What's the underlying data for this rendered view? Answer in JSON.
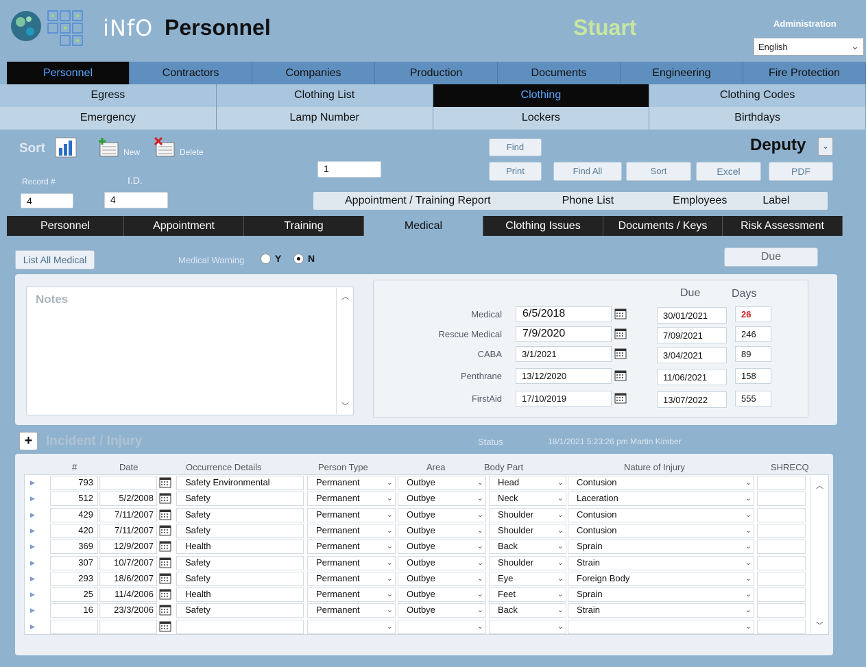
{
  "header": {
    "logo_text": "iNfO",
    "app_title": "Personnel",
    "user_name": "Stuart",
    "admin_label": "Administration",
    "language": "English"
  },
  "main_nav": [
    "Personnel",
    "Contractors",
    "Companies",
    "Production",
    "Documents",
    "Engineering",
    "Fire Protection"
  ],
  "main_nav_active": 0,
  "sub_nav_row1": [
    "Egress",
    "Clothing List",
    "Clothing",
    "Clothing Codes"
  ],
  "sub_nav_row1_active": 2,
  "sub_nav_row2": [
    "Emergency",
    "Lamp Number",
    "Lockers",
    "Birthdays"
  ],
  "toolbar": {
    "sort_label": "Sort",
    "new_label": "New",
    "delete_label": "Delete",
    "find": "Find",
    "print": "Print",
    "find_all": "Find All",
    "sort": "Sort",
    "excel": "Excel",
    "pdf": "PDF",
    "deputy": "Deputy",
    "count": "1",
    "record_label": "Record #",
    "id_label": "I.D.",
    "record_value": "4",
    "id_value": "4"
  },
  "reports": [
    "Appointment / Training Report",
    "Phone List",
    "Employees",
    "Label"
  ],
  "record_tabs": [
    "Personnel",
    "Appointment",
    "Training",
    "Medical",
    "Clothing Issues",
    "Documents / Keys",
    "Risk Assessment"
  ],
  "record_tabs_active": 3,
  "medical": {
    "list_all": "List All Medical",
    "warning_label": "Medical Warning",
    "radio_y": "Y",
    "radio_n": "N",
    "radio_selected": "N",
    "due_button": "Due",
    "notes_label": "Notes",
    "due_head": "Due",
    "days_head": "Days",
    "rows": [
      {
        "label": "Medical",
        "date": "6/5/2018",
        "due": "30/01/2021",
        "days": "26",
        "overdue": true
      },
      {
        "label": "Rescue Medical",
        "date": "7/9/2020",
        "due": "7/09/2021",
        "days": "246",
        "overdue": false
      },
      {
        "label": "CABA",
        "date": "3/1/2021",
        "due": "3/04/2021",
        "days": "89",
        "overdue": false
      },
      {
        "label": "Penthrane",
        "date": "13/12/2020",
        "due": "11/06/2021",
        "days": "158",
        "overdue": false
      },
      {
        "label": "FirstAid",
        "date": "17/10/2019",
        "due": "13/07/2022",
        "days": "555",
        "overdue": false
      }
    ]
  },
  "incident": {
    "add": "+",
    "title": "Incident / Injury",
    "status_label": "Status",
    "status_value": "18/1/2021 5:23:26 pm Martin Kimber",
    "columns": {
      "num": "#",
      "date": "Date",
      "occurrence": "Occurrence Details",
      "person_type": "Person Type",
      "area": "Area",
      "body_part": "Body Part",
      "nature": "Nature of Injury",
      "shrecq": "SHRECQ"
    },
    "rows": [
      {
        "num": "793",
        "date": "",
        "occurrence": "Safety Environmental",
        "person_type": "Permanent",
        "area": "Outbye",
        "body_part": "Head",
        "nature": "Contusion"
      },
      {
        "num": "512",
        "date": "5/2/2008",
        "occurrence": "Safety",
        "person_type": "Permanent",
        "area": "Outbye",
        "body_part": "Neck",
        "nature": "Laceration"
      },
      {
        "num": "429",
        "date": "7/11/2007",
        "occurrence": "Safety",
        "person_type": "Permanent",
        "area": "Outbye",
        "body_part": "Shoulder",
        "nature": "Contusion"
      },
      {
        "num": "420",
        "date": "7/11/2007",
        "occurrence": "Safety",
        "person_type": "Permanent",
        "area": "Outbye",
        "body_part": "Shoulder",
        "nature": "Contusion"
      },
      {
        "num": "369",
        "date": "12/9/2007",
        "occurrence": "Health",
        "person_type": "Permanent",
        "area": "Outbye",
        "body_part": "Back",
        "nature": "Sprain"
      },
      {
        "num": "307",
        "date": "10/7/2007",
        "occurrence": "Safety",
        "person_type": "Permanent",
        "area": "Outbye",
        "body_part": "Shoulder",
        "nature": "Strain"
      },
      {
        "num": "293",
        "date": "18/6/2007",
        "occurrence": "Safety",
        "person_type": "Permanent",
        "area": "Outbye",
        "body_part": "Eye",
        "nature": "Foreign Body"
      },
      {
        "num": "25",
        "date": "11/4/2006",
        "occurrence": "Health",
        "person_type": "Permanent",
        "area": "Outbye",
        "body_part": "Feet",
        "nature": "Sprain"
      },
      {
        "num": "16",
        "date": "23/3/2006",
        "occurrence": "Safety",
        "person_type": "Permanent",
        "area": "Outbye",
        "body_part": "Back",
        "nature": "Strain"
      },
      {
        "num": "",
        "date": "",
        "occurrence": "",
        "person_type": "",
        "area": "",
        "body_part": "",
        "nature": ""
      }
    ]
  }
}
